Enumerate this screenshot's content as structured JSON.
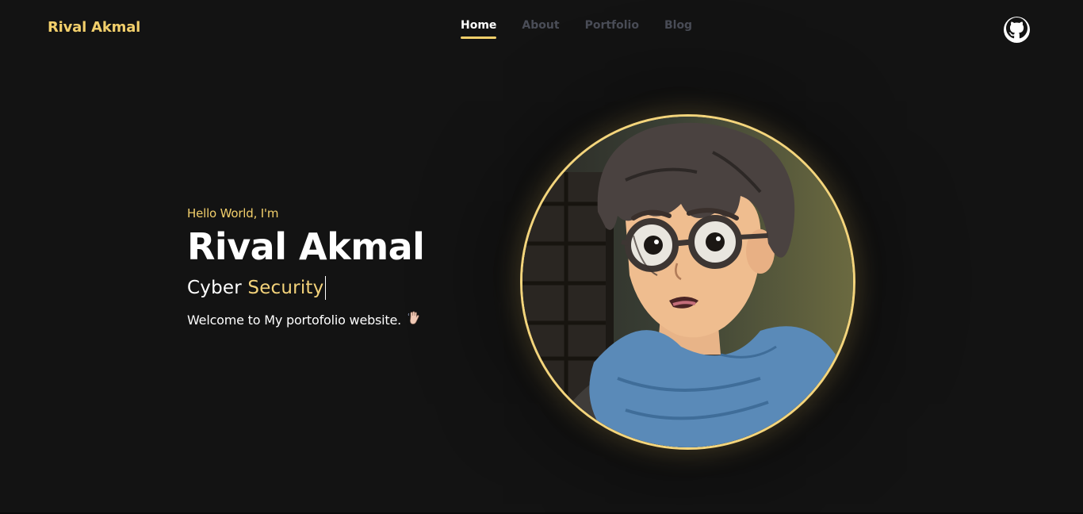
{
  "header": {
    "brand": "Rival Akmal",
    "nav": [
      {
        "label": "Home",
        "active": true
      },
      {
        "label": "About",
        "active": false
      },
      {
        "label": "Portfolio",
        "active": false
      },
      {
        "label": "Blog",
        "active": false
      }
    ],
    "github_icon": "github-icon"
  },
  "hero": {
    "greeting": "Hello World, I'm",
    "name": "Rival Akmal",
    "role_word1": "Cyber",
    "role_word2": "Security",
    "welcome": "Welcome to My portofolio website.",
    "wave_icon": "waving-hand-icon"
  },
  "avatar": {
    "subject": "anime-boy-with-glasses-and-blue-scarf"
  },
  "colors": {
    "accent": "#f2cf6b",
    "background": "#131313",
    "nav_inactive": "#4a4d57",
    "text": "#ffffff"
  }
}
